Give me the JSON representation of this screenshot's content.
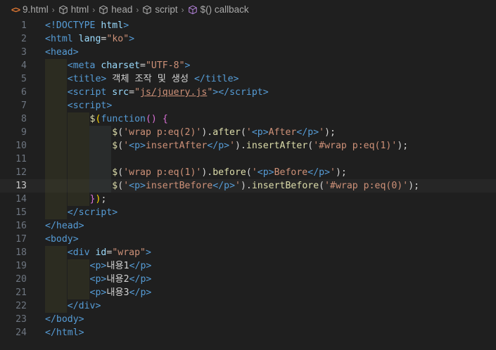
{
  "breadcrumb": {
    "file": "9.html",
    "items": [
      "html",
      "head",
      "script",
      "$() callback"
    ]
  },
  "lines": [
    {
      "n": "1",
      "html": "<span class=\"t-tag\">&lt;!DOCTYPE</span> <span class=\"t-attr\">html</span><span class=\"t-tag\">&gt;</span>"
    },
    {
      "n": "2",
      "html": "<span class=\"t-tag\">&lt;html</span> <span class=\"t-attr\">lang</span><span class=\"t-text\">=</span><span class=\"t-str\">\"ko\"</span><span class=\"t-tag\">&gt;</span>"
    },
    {
      "n": "3",
      "html": "<span class=\"t-tag\">&lt;head&gt;</span>"
    },
    {
      "n": "4",
      "html": "    <span class=\"t-tag\">&lt;meta</span> <span class=\"t-attr\">charset</span><span class=\"t-text\">=</span><span class=\"t-str\">\"UTF-8\"</span><span class=\"t-tag\">&gt;</span>"
    },
    {
      "n": "5",
      "html": "    <span class=\"t-tag\">&lt;title&gt;</span><span class=\"t-text\"> 객체 조작 및 생성 </span><span class=\"t-tag\">&lt;/title&gt;</span>"
    },
    {
      "n": "6",
      "html": "    <span class=\"t-tag\">&lt;script</span> <span class=\"t-attr\">src</span><span class=\"t-text\">=</span><span class=\"t-str\">\"</span><span class=\"t-url\">js/jquery.js</span><span class=\"t-str\">\"</span><span class=\"t-tag\">&gt;&lt;/script&gt;</span>"
    },
    {
      "n": "7",
      "html": "    <span class=\"t-tag\">&lt;script&gt;</span>"
    },
    {
      "n": "8",
      "html": "        <span class=\"t-fn\">$</span><span class=\"t-y\">(</span><span class=\"t-kw\">function</span><span class=\"t-brace\">()</span> <span class=\"t-brace\">{</span>"
    },
    {
      "n": "9",
      "html": "            <span class=\"t-fn\">$</span><span class=\"t-text\">(</span><span class=\"t-str\">'wrap p:eq(2)'</span><span class=\"t-text\">).</span><span class=\"t-fn\">after</span><span class=\"t-text\">(</span><span class=\"t-str\">'</span><span class=\"t-tag\">&lt;p&gt;</span><span class=\"t-str\">After</span><span class=\"t-tag\">&lt;/p&gt;</span><span class=\"t-str\">'</span><span class=\"t-text\">);</span>"
    },
    {
      "n": "10",
      "html": "            <span class=\"t-fn\">$</span><span class=\"t-text\">(</span><span class=\"t-str\">'</span><span class=\"t-tag\">&lt;p&gt;</span><span class=\"t-str\">insertAfter</span><span class=\"t-tag\">&lt;/p&gt;</span><span class=\"t-str\">'</span><span class=\"t-text\">).</span><span class=\"t-fn\">insertAfter</span><span class=\"t-text\">(</span><span class=\"t-str\">'#wrap p:eq(1)'</span><span class=\"t-text\">);</span>"
    },
    {
      "n": "11",
      "html": ""
    },
    {
      "n": "12",
      "html": "            <span class=\"t-fn\">$</span><span class=\"t-text\">(</span><span class=\"t-str\">'wrap p:eq(1)'</span><span class=\"t-text\">).</span><span class=\"t-fn\">before</span><span class=\"t-text\">(</span><span class=\"t-str\">'</span><span class=\"t-tag\">&lt;p&gt;</span><span class=\"t-str\">Before</span><span class=\"t-tag\">&lt;/p&gt;</span><span class=\"t-str\">'</span><span class=\"t-text\">);</span>"
    },
    {
      "n": "13",
      "html": "            <span class=\"t-fn\">$</span><span class=\"t-text\">(</span><span class=\"t-str\">'</span><span class=\"t-tag\">&lt;p&gt;</span><span class=\"t-str\">insertBefore</span><span class=\"t-tag\">&lt;/p&gt;</span><span class=\"t-str\">'</span><span class=\"t-text\">).</span><span class=\"t-fn\">insertBefore</span><span class=\"t-text\">(</span><span class=\"t-str\">'#wrap p:eq(0)'</span><span class=\"t-text\">);</span>"
    },
    {
      "n": "14",
      "html": "        <span class=\"t-brace\">}</span><span class=\"t-y\">)</span><span class=\"t-text\">;</span>"
    },
    {
      "n": "15",
      "html": "    <span class=\"t-tag\">&lt;/script&gt;</span>"
    },
    {
      "n": "16",
      "html": "<span class=\"t-tag\">&lt;/head&gt;</span>"
    },
    {
      "n": "17",
      "html": "<span class=\"t-tag\">&lt;body&gt;</span>"
    },
    {
      "n": "18",
      "html": "    <span class=\"t-tag\">&lt;div</span> <span class=\"t-attr\">id</span><span class=\"t-text\">=</span><span class=\"t-str\">\"wrap\"</span><span class=\"t-tag\">&gt;</span>"
    },
    {
      "n": "19",
      "html": "        <span class=\"t-tag\">&lt;p&gt;</span><span class=\"t-text\">내용1</span><span class=\"t-tag\">&lt;/p&gt;</span>"
    },
    {
      "n": "20",
      "html": "        <span class=\"t-tag\">&lt;p&gt;</span><span class=\"t-text\">내용2</span><span class=\"t-tag\">&lt;/p&gt;</span>"
    },
    {
      "n": "21",
      "html": "        <span class=\"t-tag\">&lt;p&gt;</span><span class=\"t-text\">내용3</span><span class=\"t-tag\">&lt;/p&gt;</span>"
    },
    {
      "n": "22",
      "html": "    <span class=\"t-tag\">&lt;/div&gt;</span>"
    },
    {
      "n": "23",
      "html": "<span class=\"t-tag\">&lt;/body&gt;</span>"
    },
    {
      "n": "24",
      "html": "<span class=\"t-tag\">&lt;/html&gt;</span>"
    }
  ],
  "active_line": "13"
}
